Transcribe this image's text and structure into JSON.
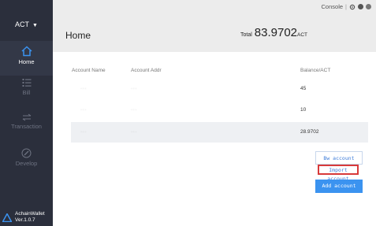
{
  "sidebar": {
    "account_selector": {
      "label": "ACT",
      "caret": "▼"
    },
    "items": [
      {
        "label": "Home",
        "icon": "home-icon",
        "active": true
      },
      {
        "label": "Bill",
        "icon": "bill-list-icon",
        "active": false
      },
      {
        "label": "Transaction",
        "icon": "transaction-arrows-icon",
        "active": false
      },
      {
        "label": "Develop",
        "icon": "pencil-circle-icon",
        "active": false
      }
    ],
    "brand": {
      "name": "AchainWallet",
      "version": "Ver.1.0.7"
    }
  },
  "header": {
    "title": "Home",
    "console": "Console",
    "total": {
      "label": "Total",
      "amount": "83.9702",
      "unit": "ACT"
    }
  },
  "table": {
    "columns": [
      "Account Name",
      "Account Addr",
      "Balance/ACT"
    ],
    "rows": [
      {
        "name": "···",
        "addr": "···",
        "balance": "45"
      },
      {
        "name": "···",
        "addr": "···",
        "balance": "10"
      },
      {
        "name": "···",
        "addr": "···",
        "balance": "28.9702"
      }
    ]
  },
  "actions": {
    "buy": "Bw account",
    "import": "Import account",
    "add": "Add account"
  },
  "colors": {
    "sidebar_bg": "#2b2f3c",
    "header_bg": "#ececec",
    "accent": "#3b93f0",
    "highlight_box": "#d83a3a"
  }
}
